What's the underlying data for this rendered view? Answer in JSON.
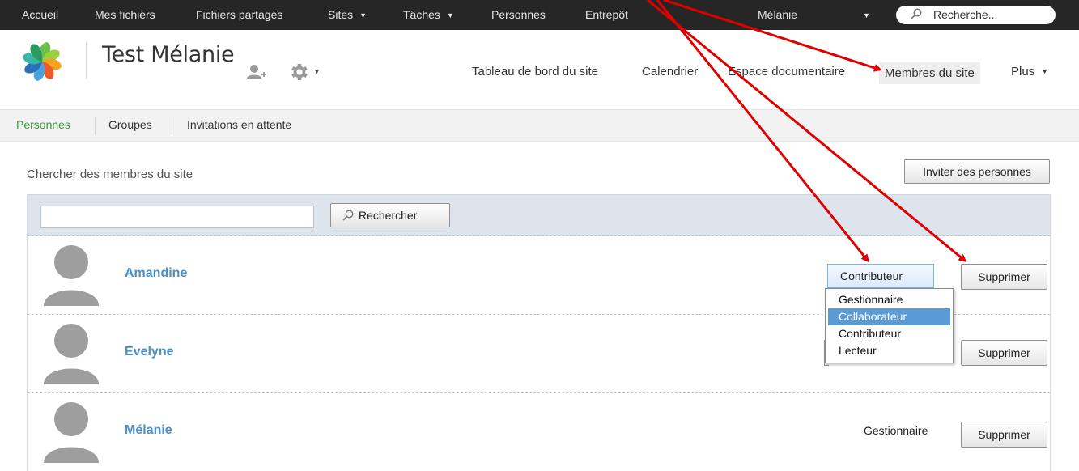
{
  "topnav": {
    "items": [
      "Accueil",
      "Mes fichiers",
      "Fichiers partagés",
      "Sites",
      "Tâches",
      "Personnes",
      "Entrepôt"
    ],
    "user": "Mélanie",
    "search_placeholder": "Recherche..."
  },
  "site": {
    "title": "Test Mélanie",
    "nav": [
      "Tableau de bord du site",
      "Calendrier",
      "Espace documentaire",
      "Membres du site",
      "Plus"
    ],
    "active_nav": "Membres du site"
  },
  "subnav": {
    "items": [
      "Personnes",
      "Groupes",
      "Invitations en attente"
    ],
    "active": "Personnes"
  },
  "main": {
    "search_label": "Chercher des membres du site",
    "invite_label": "Inviter des personnes",
    "search_input_value": "",
    "search_button_label": "Rechercher"
  },
  "members": [
    {
      "name": "Amandine",
      "role": "Contributeur",
      "remove_label": "Supprimer"
    },
    {
      "name": "Evelyne",
      "role": "",
      "remove_label": "Supprimer"
    },
    {
      "name": "Mélanie",
      "role": "Gestionnaire",
      "remove_label": "Supprimer"
    }
  ],
  "role_dropdown": {
    "options": [
      "Gestionnaire",
      "Collaborateur",
      "Contributeur",
      "Lecteur"
    ],
    "highlighted": "Collaborateur"
  },
  "colors": {
    "topbar": "#262626",
    "active_subnav": "#3a9a3a",
    "member_name": "#4a8fc7",
    "dropdown_highlight": "#5b9bd5",
    "annotation_arrow": "#e00000"
  }
}
